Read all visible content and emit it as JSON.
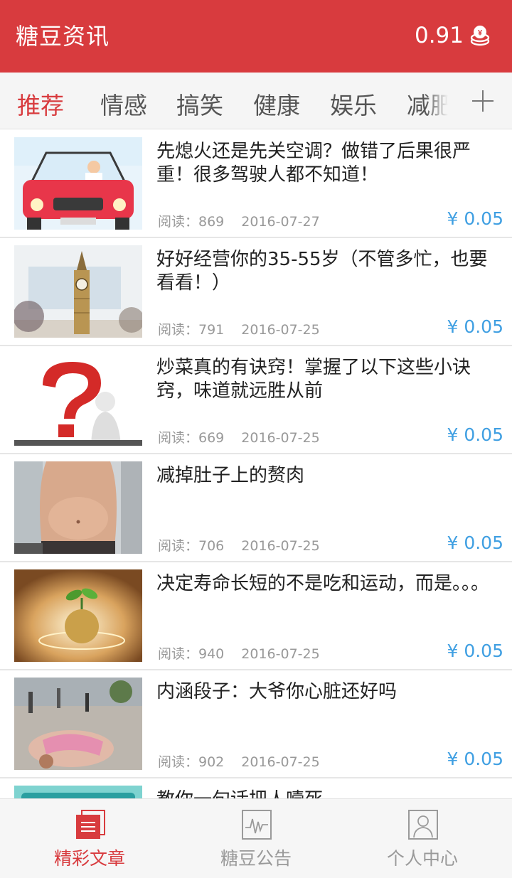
{
  "header": {
    "title": "糖豆资讯",
    "balance": "0.91",
    "balance_icon": "coin-stack-icon"
  },
  "tabs": [
    {
      "label": "推荐",
      "active": true
    },
    {
      "label": "情感"
    },
    {
      "label": "搞笑"
    },
    {
      "label": "健康"
    },
    {
      "label": "娱乐"
    },
    {
      "label": "减肥"
    }
  ],
  "add_tab_icon": "plus-icon",
  "articles": [
    {
      "title": "先熄火还是先关空调？做错了后果很严重！很多驾驶人都不知道！",
      "reads": "阅读：869",
      "date": "2016-07-27",
      "price": "¥ 0.05",
      "thumb": "car-illustration"
    },
    {
      "title": "好好经营你的35-55岁（不管多忙，也要看看！）",
      "reads": "阅读：791",
      "date": "2016-07-25",
      "price": "¥ 0.05",
      "thumb": "clock-tower"
    },
    {
      "title": "炒菜真的有诀窍！掌握了以下这些小诀窍，味道就远胜从前",
      "reads": "阅读：669",
      "date": "2016-07-25",
      "price": "¥ 0.05",
      "thumb": "question-mark"
    },
    {
      "title": "减掉肚子上的赘肉",
      "reads": "阅读：706",
      "date": "2016-07-25",
      "price": "¥ 0.05",
      "thumb": "belly-photo"
    },
    {
      "title": "决定寿命长短的不是吃和运动，而是。。。",
      "reads": "阅读：940",
      "date": "2016-07-25",
      "price": "¥ 0.05",
      "thumb": "sprout-globe"
    },
    {
      "title": "内涵段子：大爷你心脏还好吗",
      "reads": "阅读：902",
      "date": "2016-07-25",
      "price": "¥ 0.05",
      "thumb": "street-photo"
    },
    {
      "title": "教你一句话把人噎死",
      "reads": "",
      "date": "",
      "price": "",
      "thumb": "teal-banner"
    }
  ],
  "bottom_nav": [
    {
      "label": "精彩文章",
      "icon": "articles-icon",
      "active": true
    },
    {
      "label": "糖豆公告",
      "icon": "announcement-icon"
    },
    {
      "label": "个人中心",
      "icon": "profile-icon"
    }
  ],
  "colors": {
    "brand": "#d83b3e",
    "price": "#3f9fe2",
    "muted": "#999999"
  }
}
